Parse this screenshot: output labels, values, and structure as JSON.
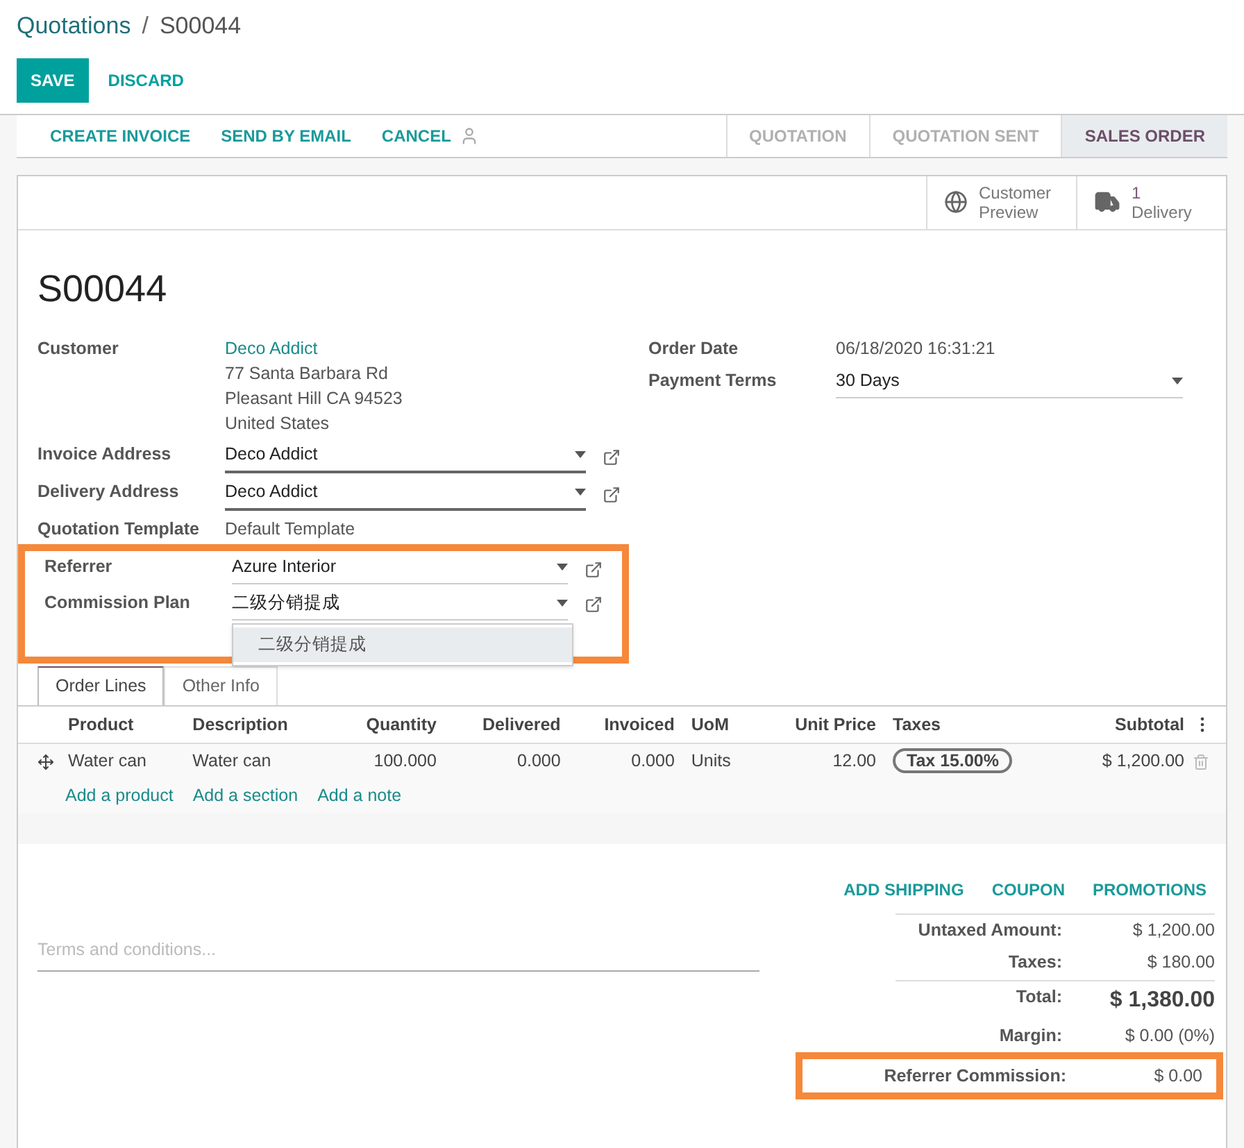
{
  "breadcrumb": {
    "parent": "Quotations",
    "separator": "/",
    "current": "S00044"
  },
  "buttons": [
    {
      "label": "SAVE",
      "kind": "primary"
    },
    {
      "label": "DISCARD",
      "kind": "link"
    }
  ],
  "actions": [
    "CREATE INVOICE",
    "SEND BY EMAIL",
    "CANCEL"
  ],
  "stages": [
    {
      "label": "QUOTATION",
      "selected": false
    },
    {
      "label": "QUOTATION SENT",
      "selected": false
    },
    {
      "label": "SALES ORDER",
      "selected": true
    }
  ],
  "smart_buttons": [
    {
      "kind": "globe",
      "lines": [
        "Customer",
        "Preview"
      ]
    },
    {
      "kind": "truck",
      "lines": [
        "1",
        "Delivery"
      ]
    }
  ],
  "title": "S00044",
  "left_fields": [
    {
      "label": "Customer",
      "kind": "address",
      "value": "Deco Addict",
      "lines": [
        "77 Santa Barbara Rd",
        "Pleasant Hill CA 94523",
        "United States"
      ]
    },
    {
      "label": "Invoice Address",
      "kind": "select",
      "value": "Deco Addict",
      "required": true
    },
    {
      "label": "Delivery Address",
      "kind": "select",
      "value": "Deco Addict",
      "required": true
    },
    {
      "label": "Quotation Template",
      "kind": "text",
      "value": "Default Template"
    }
  ],
  "highlighted_fields": [
    {
      "label": "Referrer",
      "kind": "select",
      "value": "Azure Interior",
      "required": false
    },
    {
      "label": "Commission Plan",
      "kind": "select",
      "value": "二级分销提成",
      "required": false,
      "options": [
        {
          "label": "二级分销提成",
          "selected": true
        }
      ]
    }
  ],
  "right_fields": [
    {
      "label": "Order Date",
      "kind": "text",
      "value": "06/18/2020 16:31:21"
    },
    {
      "label": "Payment Terms",
      "kind": "select",
      "value": "30 Days",
      "required": false
    }
  ],
  "tabs": [
    {
      "label": "Order Lines",
      "selected": true
    },
    {
      "label": "Other Info",
      "selected": false
    }
  ],
  "table": {
    "columns": [
      "Product",
      "Description",
      "Quantity",
      "Delivered",
      "Invoiced",
      "UoM",
      "Unit Price",
      "Taxes",
      "Subtotal"
    ],
    "rows": [
      [
        "Water can",
        "Water can",
        "100.000",
        "0.000",
        "0.000",
        "Units",
        "12.00",
        "Tax 15.00%",
        "$ 1,200.00"
      ]
    ]
  },
  "add_links": [
    "Add a product",
    "Add a section",
    "Add a note"
  ],
  "extra_actions": [
    "ADD SHIPPING",
    "COUPON",
    "PROMOTIONS"
  ],
  "terms": {
    "placeholder": "Terms and conditions..."
  },
  "totals": [
    {
      "label": "Untaxed Amount:",
      "value": "$ 1,200.00",
      "kind": "normal"
    },
    {
      "label": "Taxes:",
      "value": "$ 180.00",
      "kind": "normal"
    },
    {
      "label": "Total:",
      "value": "$ 1,380.00",
      "kind": "total"
    },
    {
      "label": "Margin:",
      "value": "$ 0.00 (0%)",
      "kind": "normal"
    }
  ],
  "highlighted_total": {
    "label": "Referrer Commission:",
    "value": "$ 0.00"
  }
}
